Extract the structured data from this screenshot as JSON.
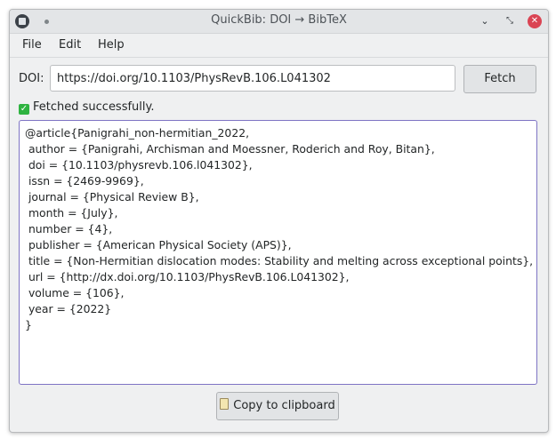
{
  "window": {
    "title": "QuickBib: DOI → BibTeX",
    "buttons": {
      "minimize": "⌄",
      "maximize": "⤡",
      "close": "✕"
    }
  },
  "menu": [
    "File",
    "Edit",
    "Help"
  ],
  "doi": {
    "label": "DOI:",
    "value": "https://doi.org/10.1103/PhysRevB.106.L041302"
  },
  "fetch_label": "Fetch",
  "status": {
    "text": "Fetched successfully.",
    "icon": "check-icon",
    "color": "#2eb340"
  },
  "bibtex": [
    "@article{Panigrahi_non-hermitian_2022,",
    " author = {Panigrahi, Archisman and Moessner, Roderich and Roy, Bitan},",
    " doi = {10.1103/physrevb.106.l041302},",
    " issn = {2469-9969},",
    " journal = {Physical Review B},",
    " month = {July},",
    " number = {4},",
    " publisher = {American Physical Society (APS)},",
    " title = {Non-Hermitian dislocation modes: Stability and melting across exceptional points},",
    " url = {http://dx.doi.org/10.1103/PhysRevB.106.L041302},",
    " volume = {106},",
    " year = {2022}",
    "}"
  ],
  "copy_label": "Copy to clipboard",
  "colors": {
    "accent": "#7e74c4",
    "close": "#da4453",
    "window_bg": "#eff0f1"
  }
}
